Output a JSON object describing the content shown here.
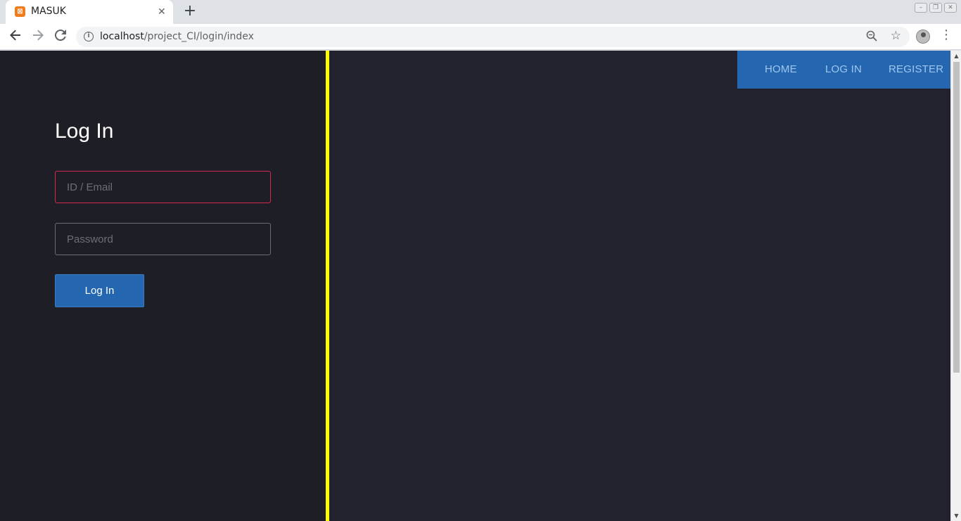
{
  "browser": {
    "tab_title": "MASUK",
    "tab_favicon": "xampp-icon",
    "close_glyph": "✕",
    "new_tab_glyph": "+",
    "url_host": "localhost",
    "url_path": "/project_CI/login/index",
    "icons": {
      "back": "back-arrow-icon",
      "forward": "forward-arrow-icon",
      "reload": "reload-icon",
      "info": "info-icon",
      "zoom": "zoom-icon",
      "bookmark": "star-icon",
      "profile": "profile-avatar-icon",
      "menu": "kebab-menu-icon"
    }
  },
  "page": {
    "title": "Log In",
    "email_placeholder": "ID / Email",
    "password_placeholder": "Password",
    "submit_label": "Log In"
  },
  "nav": {
    "home": "HOME",
    "login": "LOG IN",
    "register": "REGISTER"
  },
  "colors": {
    "accent": "#2467b0",
    "divider": "#ffff00",
    "error_border": "#d6274e",
    "background": "#1e1e26"
  }
}
